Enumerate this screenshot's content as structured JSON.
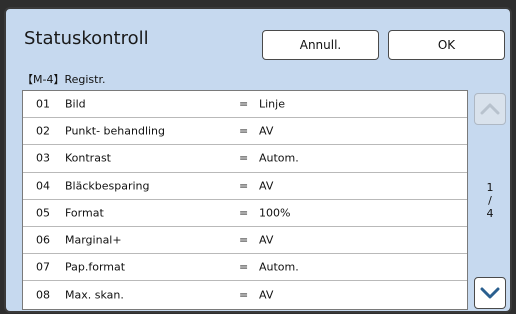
{
  "dialog": {
    "title": "Statuskontroll",
    "cancel_label": "Annull.",
    "ok_label": "OK",
    "section_label": "【M-4】Registr."
  },
  "list": {
    "rows": [
      {
        "num": "01",
        "name": "Bild",
        "eq": "=",
        "value": "Linje"
      },
      {
        "num": "02",
        "name": "Punkt- behandling",
        "eq": "=",
        "value": "AV"
      },
      {
        "num": "03",
        "name": "Kontrast",
        "eq": "=",
        "value": "Autom."
      },
      {
        "num": "04",
        "name": "Bläckbesparing",
        "eq": "=",
        "value": "AV"
      },
      {
        "num": "05",
        "name": "Format",
        "eq": "=",
        "value": "100%"
      },
      {
        "num": "06",
        "name": "Marginal+",
        "eq": "=",
        "value": "AV"
      },
      {
        "num": "07",
        "name": "Pap.format",
        "eq": "=",
        "value": "Autom."
      },
      {
        "num": "08",
        "name": "Max. skan.",
        "eq": "=",
        "value": "AV"
      }
    ]
  },
  "pager": {
    "current": "1",
    "separator": "/",
    "total": "4",
    "up_icon": "chevron-up-icon",
    "down_icon": "chevron-down-icon",
    "up_enabled": false,
    "down_enabled": true
  },
  "colors": {
    "dialog_bg": "#c6d9ef",
    "chevron_active": "#2a5f8f",
    "chevron_disabled": "#b8c2cd"
  }
}
